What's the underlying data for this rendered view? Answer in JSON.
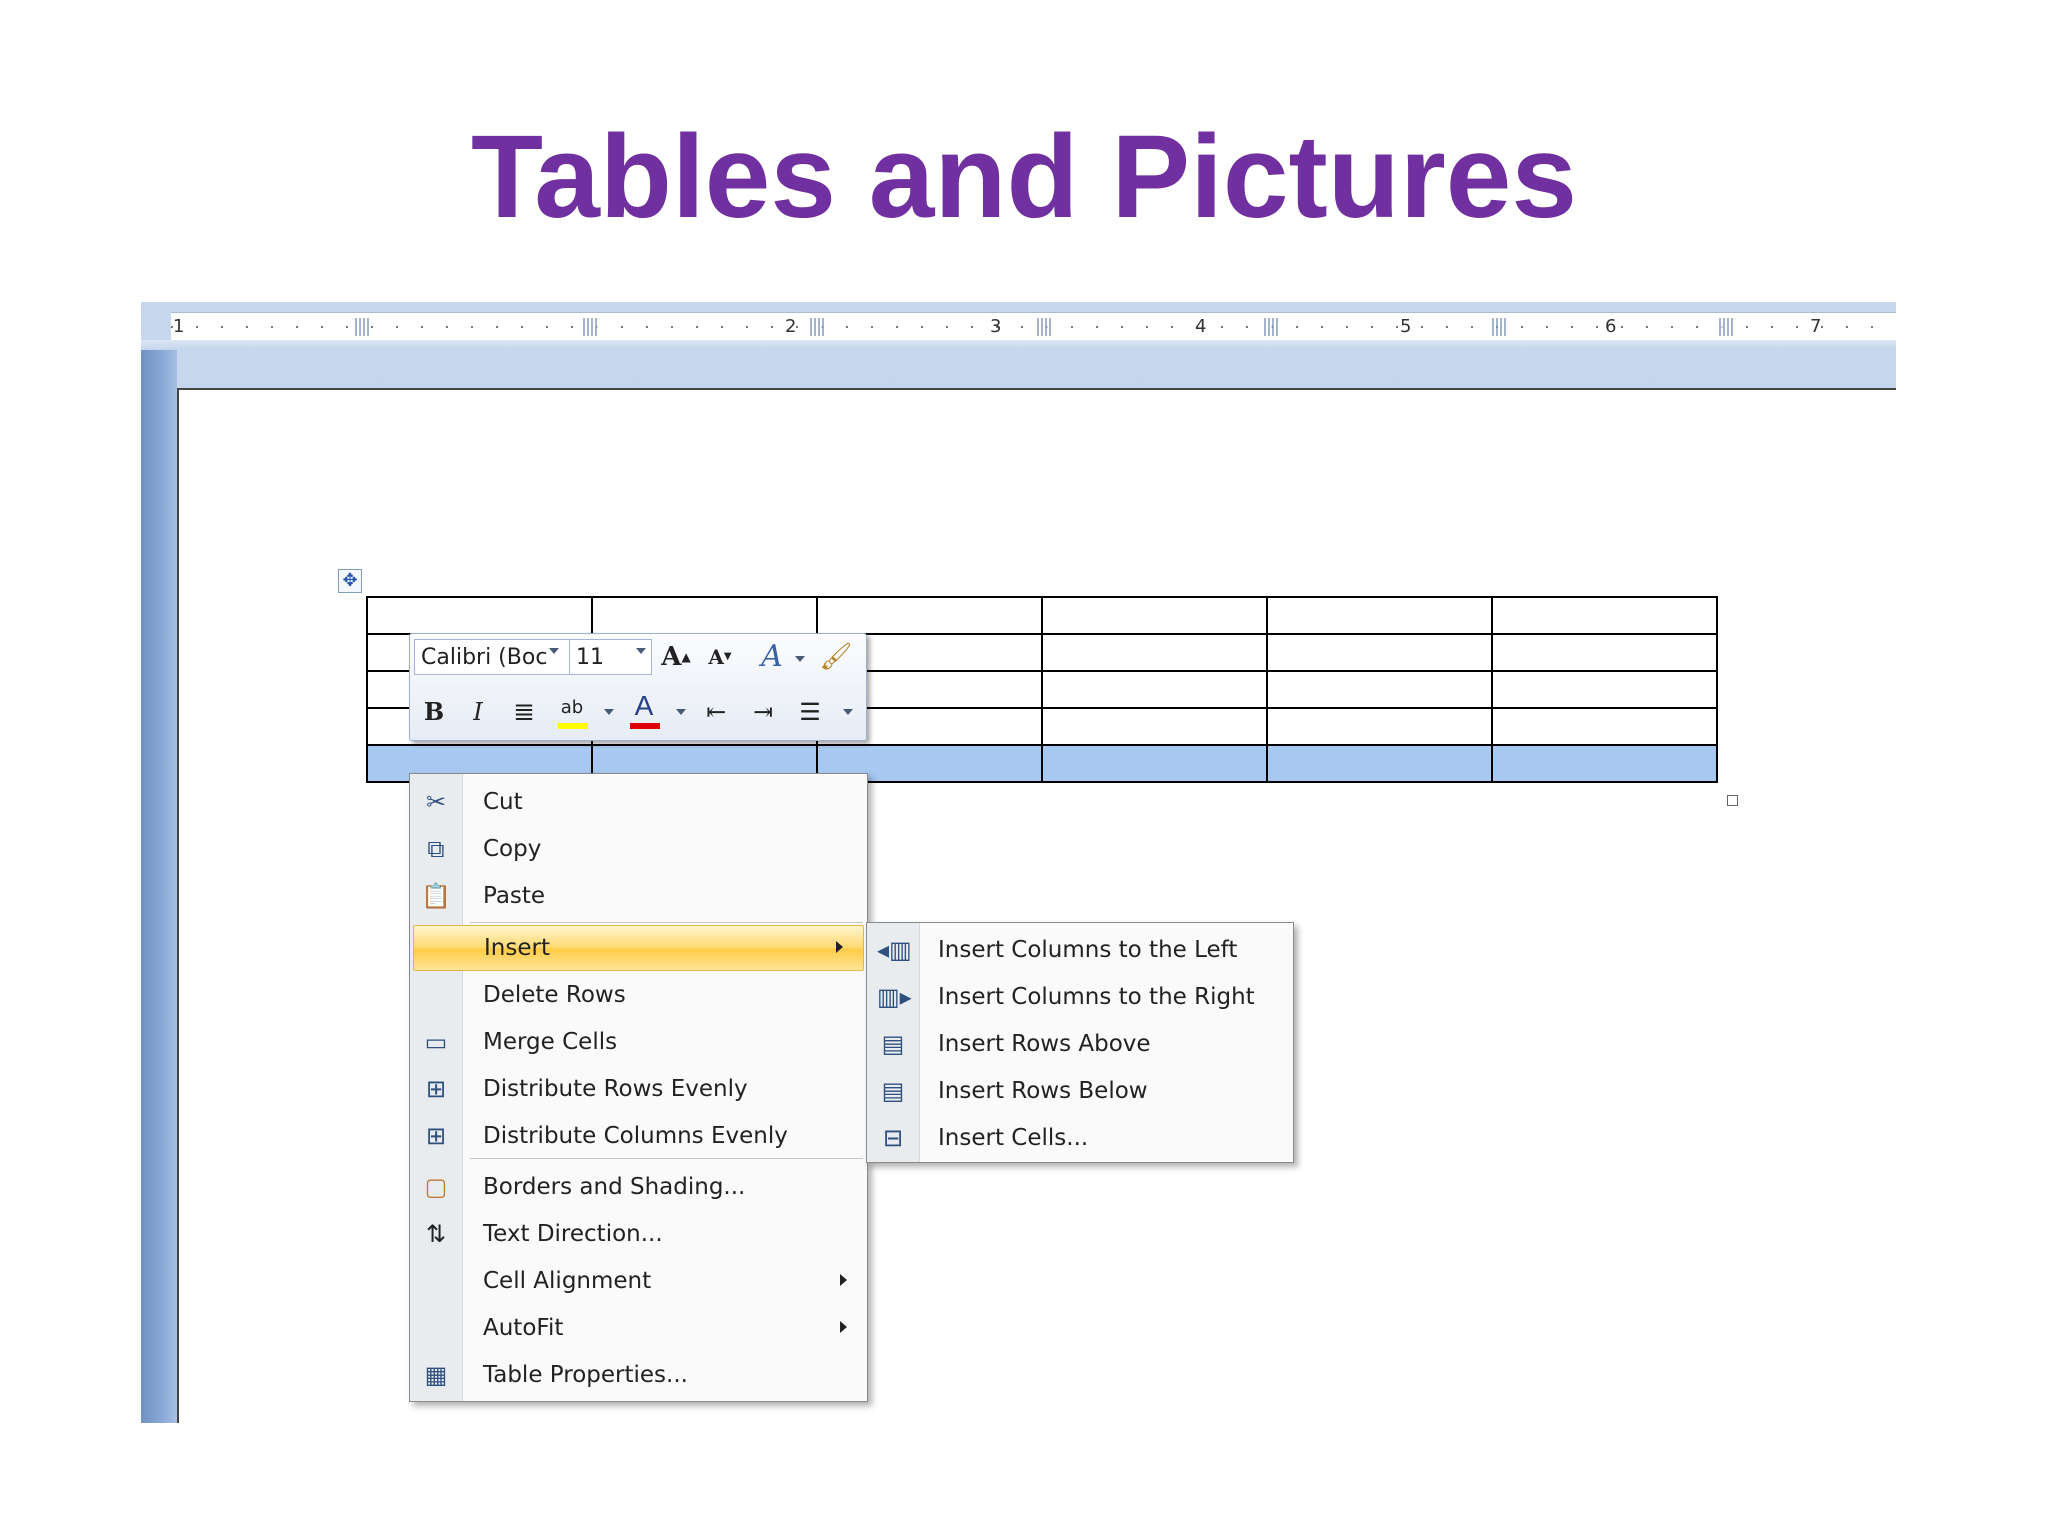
{
  "slide": {
    "title": "Tables and Pictures"
  },
  "ruler": {
    "numbers": [
      "1",
      "2",
      "3",
      "4",
      "5",
      "6",
      "7"
    ]
  },
  "mini_toolbar": {
    "font_name": "Calibri (Boc",
    "font_size": "11",
    "grow_font_icon": "grow-font-icon",
    "shrink_font_icon": "shrink-font-icon",
    "styles_icon": "styles-icon",
    "format_painter_icon": "format-painter-icon",
    "bold_label": "B",
    "italic_label": "I",
    "highlight_label": "ab",
    "font_color_label": "A",
    "highlight_color": "#ffff00",
    "font_color": "#e00000"
  },
  "context_menu": {
    "items": [
      {
        "label": "Cut",
        "icon": "scissors-icon"
      },
      {
        "label": "Copy",
        "icon": "copy-icon"
      },
      {
        "label": "Paste",
        "icon": "paste-icon"
      },
      {
        "label": "Insert",
        "icon": "",
        "highlighted": true,
        "submenu": true
      },
      {
        "label": "Delete Rows",
        "icon": ""
      },
      {
        "label": "Merge Cells",
        "icon": "merge-cells-icon"
      },
      {
        "label": "Distribute Rows Evenly",
        "icon": "distribute-rows-icon"
      },
      {
        "label": "Distribute Columns Evenly",
        "icon": "distribute-columns-icon"
      },
      {
        "label": "Borders and Shading...",
        "icon": "borders-shading-icon"
      },
      {
        "label": "Text Direction...",
        "icon": "text-direction-icon"
      },
      {
        "label": "Cell Alignment",
        "icon": "",
        "submenu": true
      },
      {
        "label": "AutoFit",
        "icon": "",
        "submenu": true
      },
      {
        "label": "Table Properties...",
        "icon": "table-properties-icon"
      }
    ]
  },
  "insert_submenu": {
    "items": [
      {
        "label": "Insert Columns to the Left",
        "icon": "insert-columns-left-icon"
      },
      {
        "label": "Insert Columns to the Right",
        "icon": "insert-columns-right-icon"
      },
      {
        "label": "Insert Rows Above",
        "icon": "insert-rows-above-icon"
      },
      {
        "label": "Insert Rows Below",
        "icon": "insert-rows-below-icon"
      },
      {
        "label": "Insert Cells...",
        "icon": "insert-cells-icon"
      }
    ]
  },
  "colors": {
    "title": "#7030a0",
    "selection": "#a7c8f0",
    "menu_highlight": "#ffd970"
  }
}
